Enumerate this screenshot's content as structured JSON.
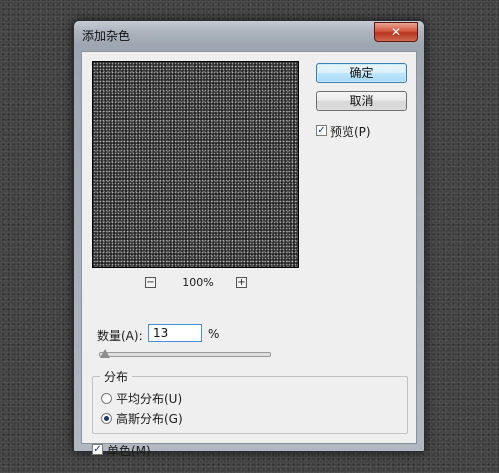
{
  "dialog": {
    "title": "添加杂色",
    "close_label": "✕"
  },
  "buttons": {
    "ok": "确定",
    "cancel": "取消"
  },
  "preview": {
    "label": "预览(P)",
    "checked": true,
    "zoom_out": "−",
    "zoom_in": "+",
    "zoom_value": "100%"
  },
  "amount": {
    "label": "数量(A):",
    "value": "13",
    "unit": "%",
    "slider_fraction": 0.033
  },
  "distribution": {
    "legend": "分布",
    "options": [
      {
        "label": "平均分布(U)",
        "checked": false
      },
      {
        "label": "高斯分布(G)",
        "checked": true
      }
    ]
  },
  "monochromatic": {
    "label": "单色(M)",
    "checked": true
  },
  "check_mark": "✓"
}
